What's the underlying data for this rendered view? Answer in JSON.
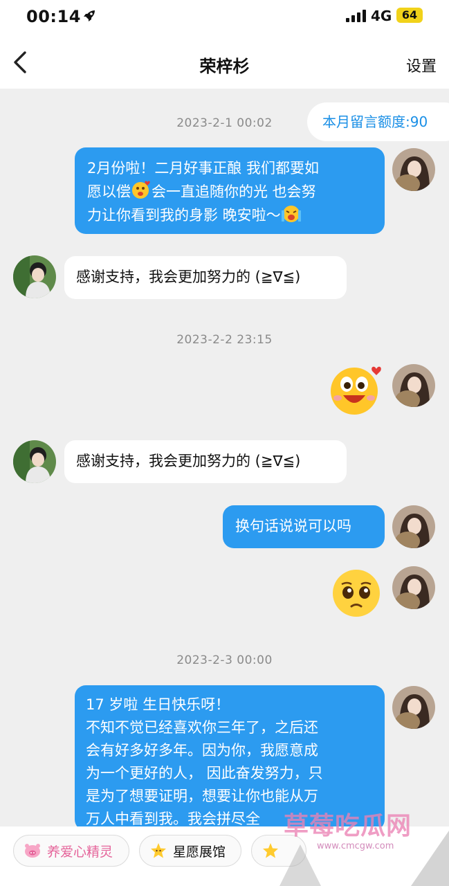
{
  "status_bar": {
    "time": "00:14",
    "network": "4G",
    "battery": "64"
  },
  "header": {
    "title": "荣梓杉",
    "settings_label": "设置"
  },
  "quota": {
    "label": "本月留言额度:90"
  },
  "messages": {
    "ts1": "2023-2-1 00:02",
    "m1_line1": "2月份啦！二月好事正酿 我们都要如",
    "m1_line2a": "愿以偿",
    "m1_line2b": "会一直追随你的光  也会努",
    "m1_line3": "力让你看到我的身影  晚安啦～",
    "r1": "感谢支持，我会更加努力的 (≧∇≦)",
    "ts2": "2023-2-2 23:15",
    "r2": "感谢支持，我会更加努力的 (≧∇≦)",
    "m3": "换句话说说可以吗",
    "ts3": "2023-2-3 00:00",
    "m5_lines": [
      "17 岁啦 生日快乐呀！",
      "不知不觉已经喜欢你三年了，之后还",
      "会有好多好多年。因为你，我愿意成",
      "为一个更好的人， 因此奋发努力，只",
      "是为了想要证明，想要让你也能从万",
      "万人中看到我。我会拼尽全"
    ]
  },
  "bottom": {
    "chip1": "养爱心精灵",
    "chip2": "星愿展馆"
  },
  "watermark": {
    "text": "草莓吃瓜网",
    "url": "www.cmcgw.com"
  }
}
